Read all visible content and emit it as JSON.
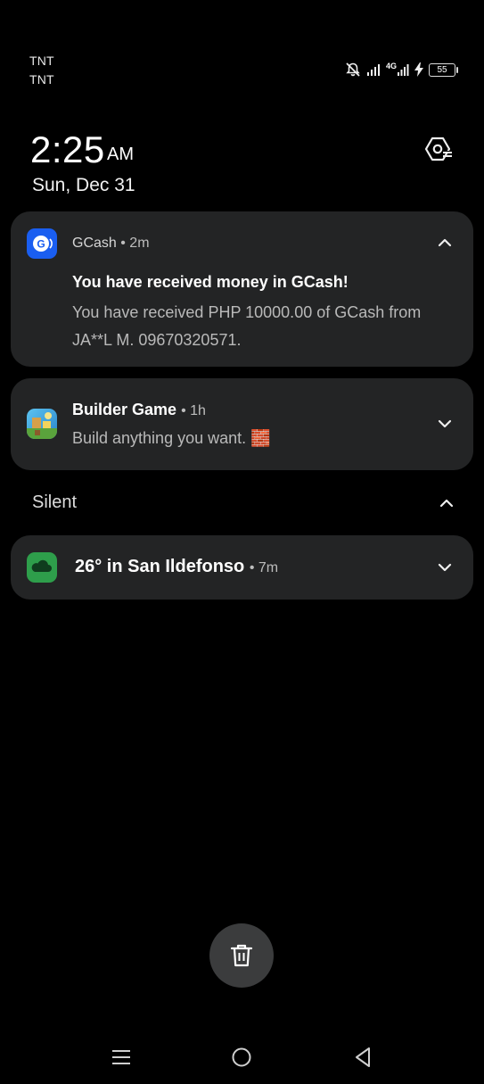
{
  "status_bar": {
    "carrier_1": "TNT",
    "carrier_2": "TNT",
    "network_type": "4G",
    "battery_level": "55",
    "icons": [
      "bell-muted-icon",
      "signal-icon",
      "signal-4g-icon",
      "charging-bolt-icon",
      "battery-icon"
    ]
  },
  "clock": {
    "time": "2:25",
    "ampm": "AM",
    "date": "Sun, Dec 31",
    "settings_icon": "settings-gear-icon"
  },
  "notifications": [
    {
      "app": "GCash",
      "time": "2m",
      "title": "You have received money in GCash!",
      "body": "You have received PHP 10000.00 of GCash from JA**L M. 09670320571.",
      "expanded": true,
      "icon": "gcash-icon",
      "accent": "#1a5ef0"
    },
    {
      "app": "Builder Game",
      "time": "1h",
      "body": "Build anything you want. 🧱",
      "expanded": false,
      "icon": "builder-game-icon"
    }
  ],
  "silent_section": {
    "label": "Silent",
    "items": [
      {
        "title": "26° in San Ildefonso",
        "time": "7m",
        "icon": "weather-cloud-icon",
        "accent": "#2e9e4b",
        "expanded": false
      }
    ]
  },
  "clear_all_icon": "trash-icon",
  "nav_bar": [
    "recents-icon",
    "home-icon",
    "back-icon"
  ]
}
